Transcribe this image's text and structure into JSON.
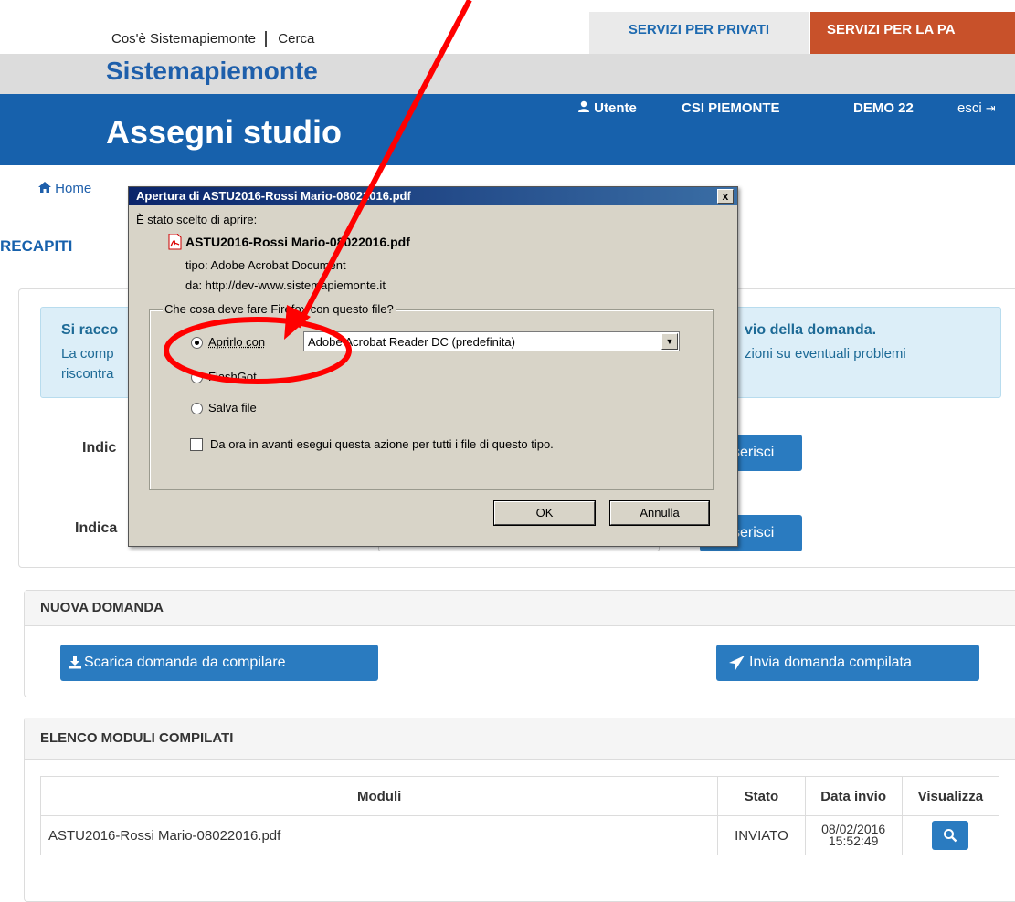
{
  "header": {
    "top_link_1": "Cos'è Sistemapiemonte",
    "top_link_2": "Cerca",
    "tab_privati": "SERVIZI PER PRIVATI",
    "tab_pa": "SERVIZI PER LA PA",
    "brand": "Sistemapiemonte",
    "app_title": "Assegni studio",
    "user_label": "Utente",
    "user_org": "CSI PIEMONTE",
    "user_name": "DEMO 22",
    "logout": "esci"
  },
  "breadcrumb": {
    "home": "Home"
  },
  "recapiti": {
    "heading": "RECAPITI",
    "alert_bold_left": "Si racco",
    "alert_bold_right": "vio della domanda.",
    "alert_line1_left": "La comp",
    "alert_line1_right": "zioni su eventuali problemi",
    "alert_line2_left": "riscontra",
    "row1_label": "Indic",
    "row1_button": "serisci",
    "row2_label": "Indica",
    "row2_button": "serisci"
  },
  "nuova_domanda": {
    "title": "NUOVA DOMANDA",
    "download_button": "Scarica domanda da compilare",
    "send_button": "Invia domanda compilata"
  },
  "elenco": {
    "title": "ELENCO MODULI COMPILATI",
    "columns": [
      "Moduli",
      "Stato",
      "Data invio",
      "Visualizza"
    ],
    "rows": [
      {
        "modulo": "ASTU2016-Rossi Mario-08022016.pdf",
        "stato": "INVIATO",
        "data_line1": "08/02/2016",
        "data_line2": "15:52:49"
      }
    ]
  },
  "dialog": {
    "title": "Apertura di ASTU2016-Rossi Mario-08022016.pdf",
    "close": "x",
    "intro": "È stato scelto di aprire:",
    "filename": "ASTU2016-Rossi Mario-08022016.pdf",
    "tipo": "tipo:  Adobe Acrobat Document",
    "da": "da:  http://dev-www.sistemapiemonte.it",
    "question": "Che cosa deve fare Firefox con questo file?",
    "option_open": "Aprirlo con",
    "option_open_app": "Adobe Acrobat Reader DC  (predefinita)",
    "option_flashgot": "FlashGot",
    "option_save": "Salva file",
    "remember": "Da ora in avanti esegui questa azione per tutti i file di questo tipo.",
    "ok": "OK",
    "cancel": "Annulla"
  },
  "colors": {
    "brand_blue": "#1761ac",
    "pa_orange": "#c8512a",
    "annotation_red": "#ff0000"
  }
}
